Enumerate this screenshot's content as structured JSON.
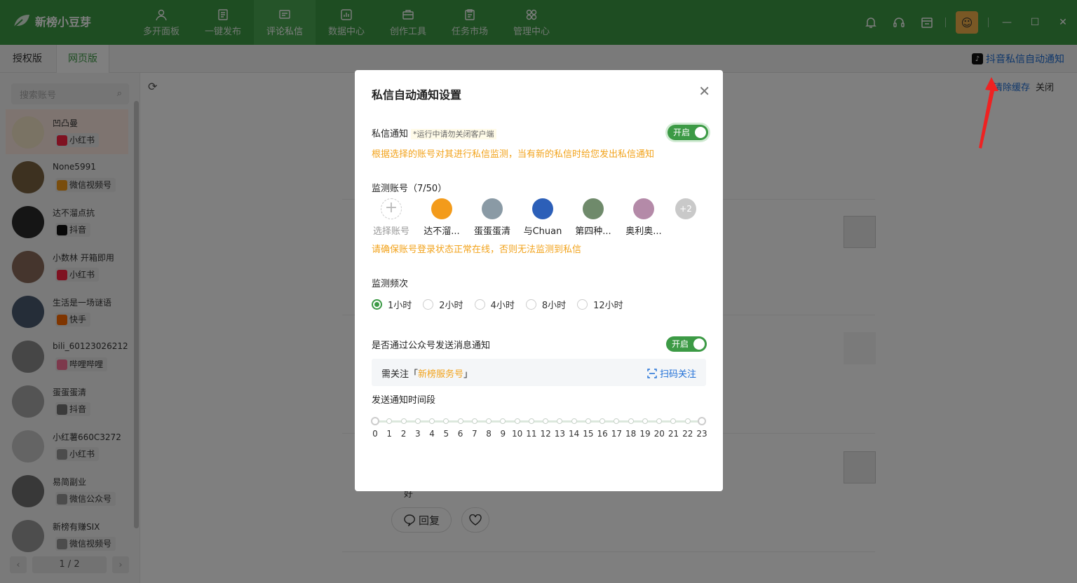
{
  "app": {
    "name": "新榜小豆芽"
  },
  "nav": [
    {
      "label": "多开面板",
      "icon": "user-icon"
    },
    {
      "label": "一键发布",
      "icon": "document-icon"
    },
    {
      "label": "评论私信",
      "icon": "message-icon"
    },
    {
      "label": "数据中心",
      "icon": "chart-icon"
    },
    {
      "label": "创作工具",
      "icon": "toolbox-icon"
    },
    {
      "label": "任务市场",
      "icon": "clipboard-icon"
    },
    {
      "label": "管理中心",
      "icon": "grid-icon"
    }
  ],
  "subtabs": [
    "授权版",
    "网页版"
  ],
  "top_link": "抖音私信自动通知",
  "sidebar": {
    "search_placeholder": "搜索账号",
    "accounts": [
      {
        "name": "凹凸曼",
        "platform": "小红书",
        "color": "#ff2442"
      },
      {
        "name": "None5991",
        "platform": "微信视频号",
        "color": "#f39b1b"
      },
      {
        "name": "达不溜点抗",
        "platform": "抖音",
        "color": "#111111"
      },
      {
        "name": "小数林 开箱即用",
        "platform": "小红书",
        "color": "#ff2442"
      },
      {
        "name": "生活是一场谜语",
        "platform": "快手",
        "color": "#ff6a00"
      },
      {
        "name": "bili_60123026212",
        "platform": "哔哩哔哩",
        "color": "#fb7299"
      },
      {
        "name": "蛋蛋蛋清",
        "platform": "抖音",
        "color": "#777777"
      },
      {
        "name": "小红薯660C3272",
        "platform": "小红书",
        "color": "#999999"
      },
      {
        "name": "易简副业",
        "platform": "微信公众号",
        "color": "#999999"
      },
      {
        "name": "新榜有赚SIX",
        "platform": "微信视频号",
        "color": "#999999"
      }
    ],
    "pager": "1 / 2"
  },
  "content": {
    "clear_cache": "清除缓存",
    "close": "关闭",
    "reply": "回复",
    "comment_tail": "好"
  },
  "modal": {
    "title": "私信自动通知设置",
    "dm_label": "私信通知",
    "dm_hint": "*运行中请勿关闭客户端",
    "toggle_on": "开启",
    "dm_desc": "根据选择的账号对其进行私信监测，当有新的私信时给您发出私信通知",
    "monitor_label": "监测账号（7/50）",
    "monitor_add": "选择账号",
    "monitor_accounts": [
      {
        "name": "达不溜...",
        "color": "#f39b1b"
      },
      {
        "name": "蛋蛋蛋清",
        "color": "#8a9aa5"
      },
      {
        "name": "与Chuan",
        "color": "#2c5fb8"
      },
      {
        "name": "第四种...",
        "color": "#6f8a6b"
      },
      {
        "name": "奥利奥...",
        "color": "#b48aa8"
      }
    ],
    "monitor_more": "+2",
    "monitor_warn": "请确保账号登录状态正常在线，否则无法监测到私信",
    "freq_label": "监测频次",
    "freq_options": [
      "1小时",
      "2小时",
      "4小时",
      "8小时",
      "12小时"
    ],
    "freq_selected": "1小时",
    "wx_label": "是否通过公众号发送消息通知",
    "follow_prefix": "需关注「",
    "follow_name": "新榜服务号",
    "follow_suffix": "」",
    "scan_label": "扫码关注",
    "period_label": "发送通知时间段",
    "hours": [
      "0",
      "1",
      "2",
      "3",
      "4",
      "5",
      "6",
      "7",
      "8",
      "9",
      "10",
      "11",
      "12",
      "13",
      "14",
      "15",
      "16",
      "17",
      "18",
      "19",
      "20",
      "21",
      "22",
      "23"
    ]
  }
}
